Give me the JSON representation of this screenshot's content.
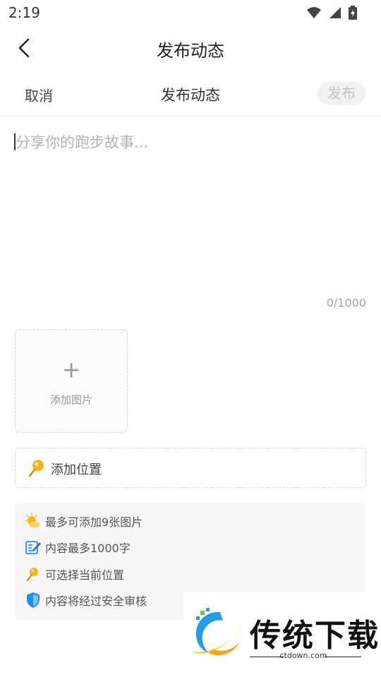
{
  "status": {
    "time": "2:19"
  },
  "header": {
    "title": "发布动态"
  },
  "action_bar": {
    "cancel": "取消",
    "title": "发布动态",
    "publish": "发布"
  },
  "editor": {
    "placeholder": "分享你的跑步故事...",
    "counter": "0/1000"
  },
  "photo": {
    "plus": "+",
    "label": "添加图片"
  },
  "location": {
    "label": "添加位置"
  },
  "tips": [
    {
      "icon": "sun-cloud-icon",
      "text": "最多可添加9张图片"
    },
    {
      "icon": "edit-note-icon",
      "text": "内容最多1000字"
    },
    {
      "icon": "pin-icon",
      "text": "可选择当前位置"
    },
    {
      "icon": "shield-icon",
      "text": "内容将经过安全审核"
    }
  ],
  "watermark": {
    "name": "传统下载",
    "url": "ctdown.com"
  },
  "colors": {
    "pin": "#f6b21e",
    "shield": "#1f8fe6",
    "edit": "#2a79c9",
    "publish_bg": "#f1f1f1"
  }
}
